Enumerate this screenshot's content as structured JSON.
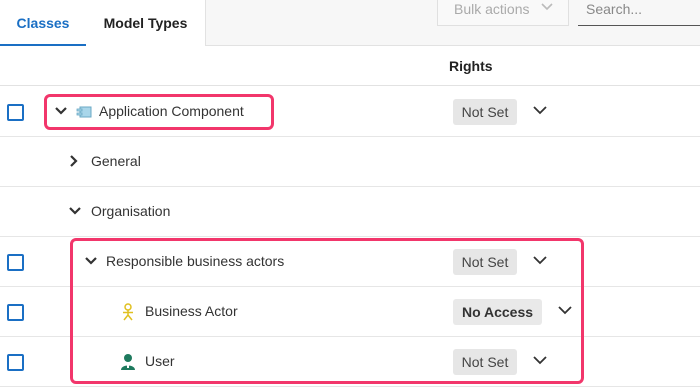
{
  "tabs": [
    {
      "label": "Classes",
      "active": true
    },
    {
      "label": "Model Types",
      "active": false
    }
  ],
  "toolbar": {
    "bulk_label": "Bulk actions",
    "search_placeholder": "Search..."
  },
  "header": {
    "rights_label": "Rights"
  },
  "rows": [
    {
      "label": "Application Component",
      "rights": "Not Set",
      "has_checkbox": true,
      "expanded": true,
      "icon": "application-component-icon"
    },
    {
      "label": "General",
      "rights": "",
      "has_checkbox": false,
      "expanded": false
    },
    {
      "label": "Organisation",
      "rights": "",
      "has_checkbox": false,
      "expanded": true
    },
    {
      "label": "Responsible business actors",
      "rights": "Not Set",
      "has_checkbox": true,
      "expanded": true
    },
    {
      "label": "Business Actor",
      "rights": "No Access",
      "has_checkbox": true,
      "icon": "business-actor-icon"
    },
    {
      "label": "User",
      "rights": "Not Set",
      "has_checkbox": true,
      "icon": "user-icon"
    }
  ],
  "colors": {
    "accent": "#1a6fc4",
    "highlight": "#f2366b",
    "pill_bg": "#e6e6e6",
    "actor_icon": "#e0c020",
    "user_icon": "#1e7a5e"
  }
}
